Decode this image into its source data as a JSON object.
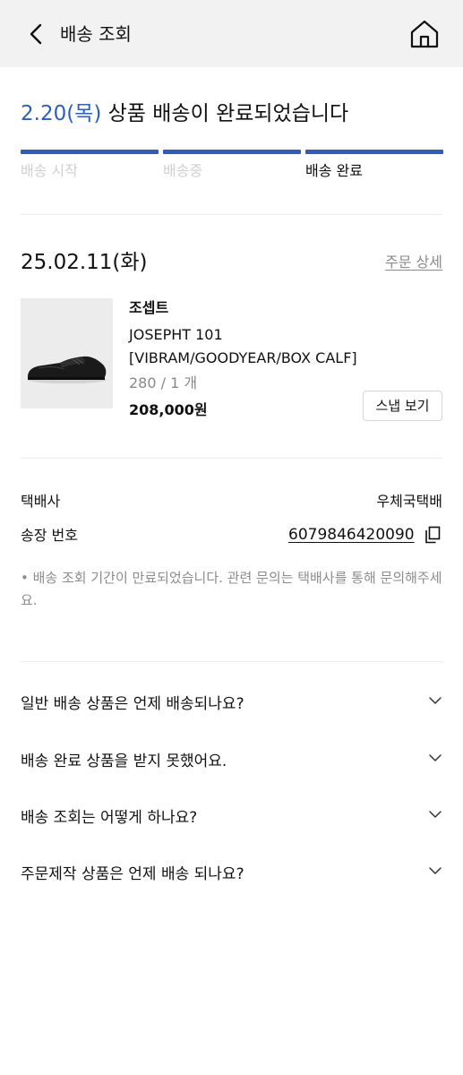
{
  "header": {
    "title": "배송 조회",
    "back_icon": "chevron-left-icon",
    "home_icon": "home-icon"
  },
  "status": {
    "date": "2.20(목)",
    "message": "상품 배송이 완료되었습니다",
    "accent_color": "#2b5fbf",
    "progress_color": "#2c5cc5",
    "steps": [
      {
        "label": "배송 시작",
        "state": "done"
      },
      {
        "label": "배송중",
        "state": "done"
      },
      {
        "label": "배송 완료",
        "state": "current"
      }
    ]
  },
  "order": {
    "date": "25.02.11(화)",
    "detail_link": "주문 상세",
    "product": {
      "brand": "조셉트",
      "name_line1": "JOSEPHT 101",
      "name_line2": "[VIBRAM/GOODYEAR/BOX CALF]",
      "option": "280 / 1 개",
      "price": "208,000원",
      "image": "black-leather-derby-shoe"
    },
    "snap_button": "스냅 보기"
  },
  "delivery": {
    "courier_label": "택배사",
    "courier_value": "우체국택배",
    "tracking_label": "송장 번호",
    "tracking_number": "6079846420090",
    "copy_icon": "copy-icon",
    "notice": "• 배송 조회 기간이 만료되었습니다. 관련 문의는 택배사를 통해 문의해주세요."
  },
  "faq": [
    {
      "question": "일반 배송 상품은 언제 배송되나요?"
    },
    {
      "question": "배송 완료 상품을 받지 못했어요."
    },
    {
      "question": "배송 조회는 어떻게 하나요?"
    },
    {
      "question": "주문제작 상품은 언제 배송 되나요?"
    }
  ]
}
